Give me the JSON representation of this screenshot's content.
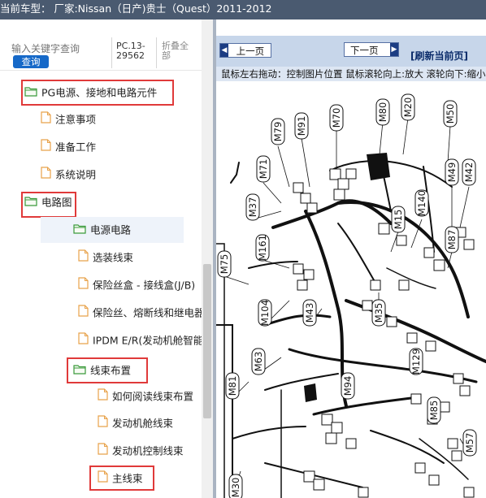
{
  "window": {
    "title": "当前车型： 厂家:Nissan（日产)贵士（Quest）2011-2012"
  },
  "search": {
    "placeholder": "输入关键字查询",
    "button_label": "查询",
    "code": "PC.13-29562",
    "collapse_label": "折叠全部"
  },
  "tree": {
    "items": [
      {
        "label": "PG电源、接地和电路元件",
        "icon": "folder-open-icon",
        "highlighted": true
      },
      {
        "label": "注意事项",
        "icon": "document-icon"
      },
      {
        "label": "准备工作",
        "icon": "document-icon"
      },
      {
        "label": "系统说明",
        "icon": "document-icon"
      },
      {
        "label": "电路图",
        "icon": "folder-open-icon",
        "highlighted": true
      },
      {
        "label": "电源电路",
        "icon": "folder-open-icon",
        "selected": true
      },
      {
        "label": "选装线束",
        "icon": "document-icon"
      },
      {
        "label": "保险丝盒 - 接线盒(J/B)",
        "icon": "document-icon"
      },
      {
        "label": "保险丝、熔断线和继电器",
        "icon": "document-icon"
      },
      {
        "label": "IPDM E/R(发动机舱智能配电模块)",
        "icon": "document-icon"
      },
      {
        "label": "线束布置",
        "icon": "folder-open-icon",
        "highlighted": true
      },
      {
        "label": "如何阅读线束布置",
        "icon": "document-icon"
      },
      {
        "label": "发动机舱线束",
        "icon": "document-icon"
      },
      {
        "label": "发动机控制线束",
        "icon": "document-icon"
      },
      {
        "label": "主线束",
        "icon": "document-icon",
        "highlighted": true
      }
    ]
  },
  "viewer": {
    "prev_label": "上一页",
    "next_label": "下一页",
    "refresh_label": "[刷新当前页]",
    "hint": "鼠标左右拖动：控制图片位置  鼠标滚轮向上:放大   滚轮向下:缩小"
  },
  "diagram": {
    "connector_labels": [
      "M70",
      "M80",
      "M20",
      "M50",
      "M79",
      "M91",
      "M71",
      "M49",
      "M42",
      "M37",
      "M140",
      "M15",
      "M87",
      "M161",
      "M75",
      "M43",
      "M35",
      "M104",
      "M63",
      "M129",
      "M81",
      "M94",
      "M85",
      "M57",
      "M30"
    ],
    "colors": {
      "titlebar": "#4a5a70",
      "redbox": "#e03a3a",
      "button": "#1669c8",
      "navbar": "#c7d6ea"
    }
  }
}
